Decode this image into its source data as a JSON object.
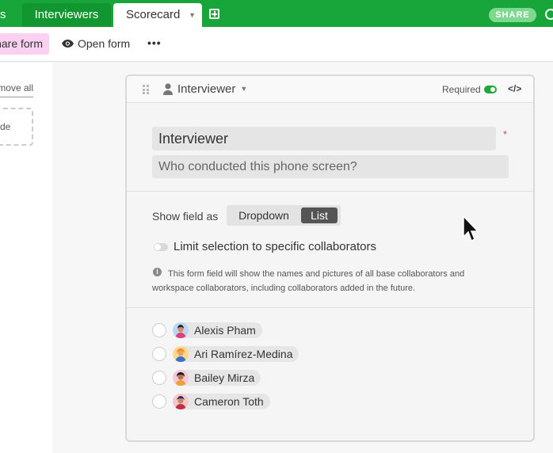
{
  "tabs": {
    "partial_label": "s",
    "interviewers_label": "Interviewers",
    "active_label": "Scorecard"
  },
  "header": {
    "share_label": "SHARE"
  },
  "toolbar": {
    "share_form_label": "Share form",
    "open_form_label": "Open form",
    "more_label": "•••"
  },
  "sidebar": {
    "remove_all_label": "Remove all",
    "hidden_box_label": "de"
  },
  "field": {
    "type_label": "Interviewer",
    "required_label": "Required",
    "required_on": true,
    "title": "Interviewer",
    "required_star": "*",
    "description_placeholder": "Who conducted this phone screen?",
    "show_field_label": "Show field as",
    "display_options": [
      "Dropdown",
      "List"
    ],
    "selected_display": "List",
    "limit_label": "Limit selection to specific collaborators",
    "limit_on": false,
    "info_text": "This form field will show the names and pictures of all base collaborators and workspace collaborators, including collaborators added in the future."
  },
  "options": [
    {
      "name": "Alexis Pham"
    },
    {
      "name": "Ari Ramírez-Medina"
    },
    {
      "name": "Bailey Mirza"
    },
    {
      "name": "Cameron Toth"
    }
  ],
  "colors": {
    "brand_green": "#18a539",
    "share_form_pink": "#fbd1f2",
    "required_star": "#e0445d"
  }
}
